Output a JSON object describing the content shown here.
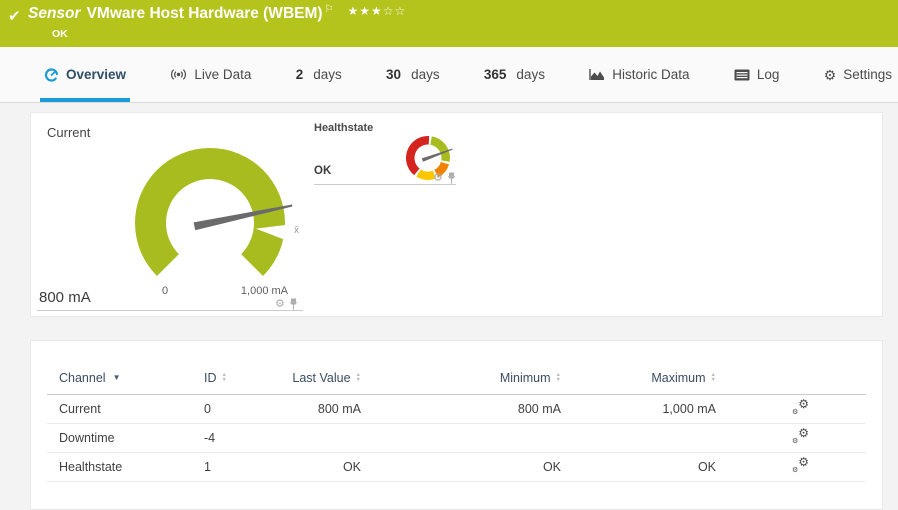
{
  "header": {
    "type_label": "Sensor",
    "title": "VMware Host Hardware (WBEM)",
    "status": "OK",
    "stars_filled": "★★★",
    "stars_empty": "☆☆",
    "flag_icon": "flag",
    "check_icon": "checkmark",
    "background_color": "#b5c31d"
  },
  "tabs": [
    {
      "label": "Overview",
      "icon": "gauge-icon",
      "active": true
    },
    {
      "label": "Live Data",
      "icon": "broadcast-icon"
    },
    {
      "prefix": "2",
      "label": "days"
    },
    {
      "prefix": "30",
      "label": "days"
    },
    {
      "prefix": "365",
      "label": "days"
    },
    {
      "label": "Historic Data",
      "icon": "area-chart-icon"
    },
    {
      "label": "Log",
      "icon": "log-icon"
    },
    {
      "label": "Settings",
      "icon": "gear-icon"
    }
  ],
  "gauges": {
    "current": {
      "title": "Current",
      "value": "800 mA",
      "scale_min": "0",
      "scale_max": "1,000 mA",
      "average_marker": "x̄",
      "color": "#a8bc1f"
    },
    "healthstate": {
      "title": "Healthstate",
      "value": "OK",
      "segment_colors": {
        "red": "#d5231e",
        "orange": "#f08200",
        "yellow": "#fdc700",
        "green": "#a8bc1f"
      }
    }
  },
  "table": {
    "headers": {
      "channel": "Channel",
      "id": "ID",
      "last_value": "Last Value",
      "minimum": "Minimum",
      "maximum": "Maximum"
    },
    "sorted_by": "Channel",
    "rows": [
      {
        "channel": "Current",
        "id": "0",
        "last_value": "800 mA",
        "minimum": "800 mA",
        "maximum": "1,000 mA"
      },
      {
        "channel": "Downtime",
        "id": "-4",
        "last_value": "",
        "minimum": "",
        "maximum": ""
      },
      {
        "channel": "Healthstate",
        "id": "1",
        "last_value": "OK",
        "minimum": "OK",
        "maximum": "OK"
      }
    ]
  },
  "colors": {
    "accent_blue": "#199cd8",
    "page_background": "#f3f3f3"
  }
}
